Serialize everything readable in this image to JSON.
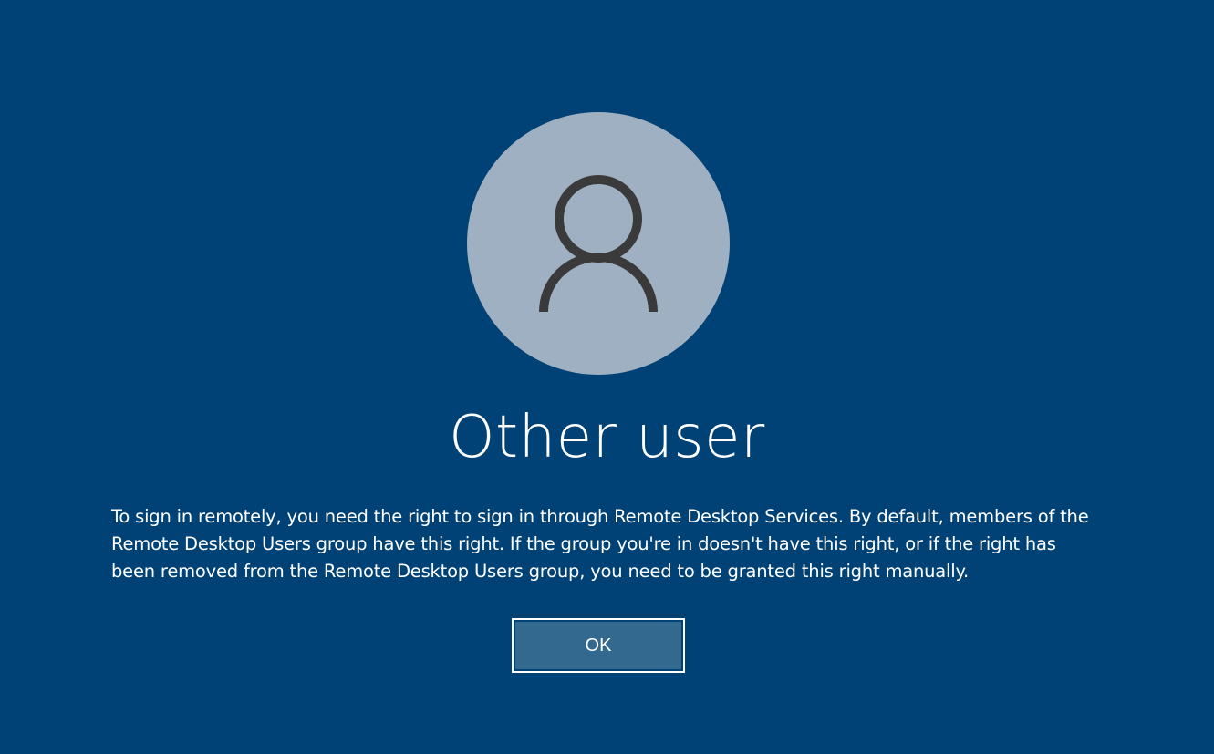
{
  "screen": {
    "background_color": "#004275",
    "avatar_color": "#9eb0c1",
    "avatar_icon": "user-icon"
  },
  "user": {
    "name": "Other user"
  },
  "dialog": {
    "message": "To sign in remotely, you need the right to sign in through Remote Desktop Services. By default, members of the Remote Desktop Users group have this right. If the group you're in doesn't have this right, or if the right has been removed from the Remote Desktop Users group, you need to be granted this right manually.",
    "ok_label": "OK"
  }
}
